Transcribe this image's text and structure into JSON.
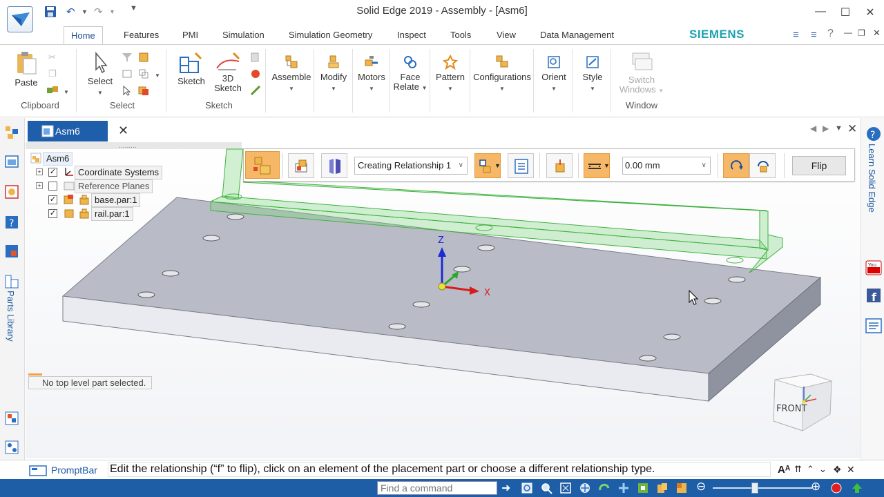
{
  "window": {
    "title": "Solid Edge 2019 - Assembly - [Asm6]",
    "controls": [
      "minimize",
      "maximize",
      "close"
    ]
  },
  "ribbon_tabs": [
    {
      "label": "Home",
      "active": true
    },
    {
      "label": "Features"
    },
    {
      "label": "PMI"
    },
    {
      "label": "Simulation"
    },
    {
      "label": "Simulation Geometry"
    },
    {
      "label": "Inspect"
    },
    {
      "label": "Tools"
    },
    {
      "label": "View"
    },
    {
      "label": "Data Management"
    }
  ],
  "brand": "SIEMENS",
  "ribbon": {
    "paste": "Paste",
    "clipboard_group": "Clipboard",
    "select": "Select",
    "select_group": "Select",
    "sketch": "Sketch",
    "sketch3d_line1": "3D",
    "sketch3d_line2": "Sketch",
    "sketch_group": "Sketch",
    "assemble": "Assemble",
    "modify": "Modify",
    "motors": "Motors",
    "face_relate_line1": "Face",
    "face_relate_line2": "Relate",
    "pattern": "Pattern",
    "configurations": "Configurations",
    "orient": "Orient",
    "style": "Style",
    "switch_windows_line1": "Switch",
    "switch_windows_line2": "Windows",
    "window_group": "Window"
  },
  "document_tab": "Asm6",
  "side_panels": {
    "parts_library": "Parts Library",
    "learn_solid_edge": "Learn Solid Edge"
  },
  "tree": {
    "root": "Asm6",
    "items": [
      {
        "label": "Coordinate Systems",
        "checked": true,
        "expander": "+"
      },
      {
        "label": "Reference Planes",
        "checked": false,
        "expander": "+"
      },
      {
        "label": "base.par:1",
        "checked": true
      },
      {
        "label": "rail.par:1",
        "checked": true
      }
    ]
  },
  "command_bar": {
    "relationship": "Creating Relationship 1",
    "offset_value": "0.00 mm",
    "flip": "Flip"
  },
  "triad": {
    "z": "Z",
    "x": "X"
  },
  "status_message": "No top level part selected.",
  "view_cube": {
    "face": "FRONT"
  },
  "prompt_bar": {
    "label": "PromptBar",
    "text": "Edit the relationship (“f” to flip), click on an element of the placement part or choose a different relationship type."
  },
  "status_bar": {
    "find_placeholder": "Find a command"
  },
  "colors": {
    "accent_blue": "#1e5ea6",
    "siemens_teal": "#1ba3b0",
    "active_button_orange": "#f6b866",
    "rail_green": "#7fd47f"
  }
}
